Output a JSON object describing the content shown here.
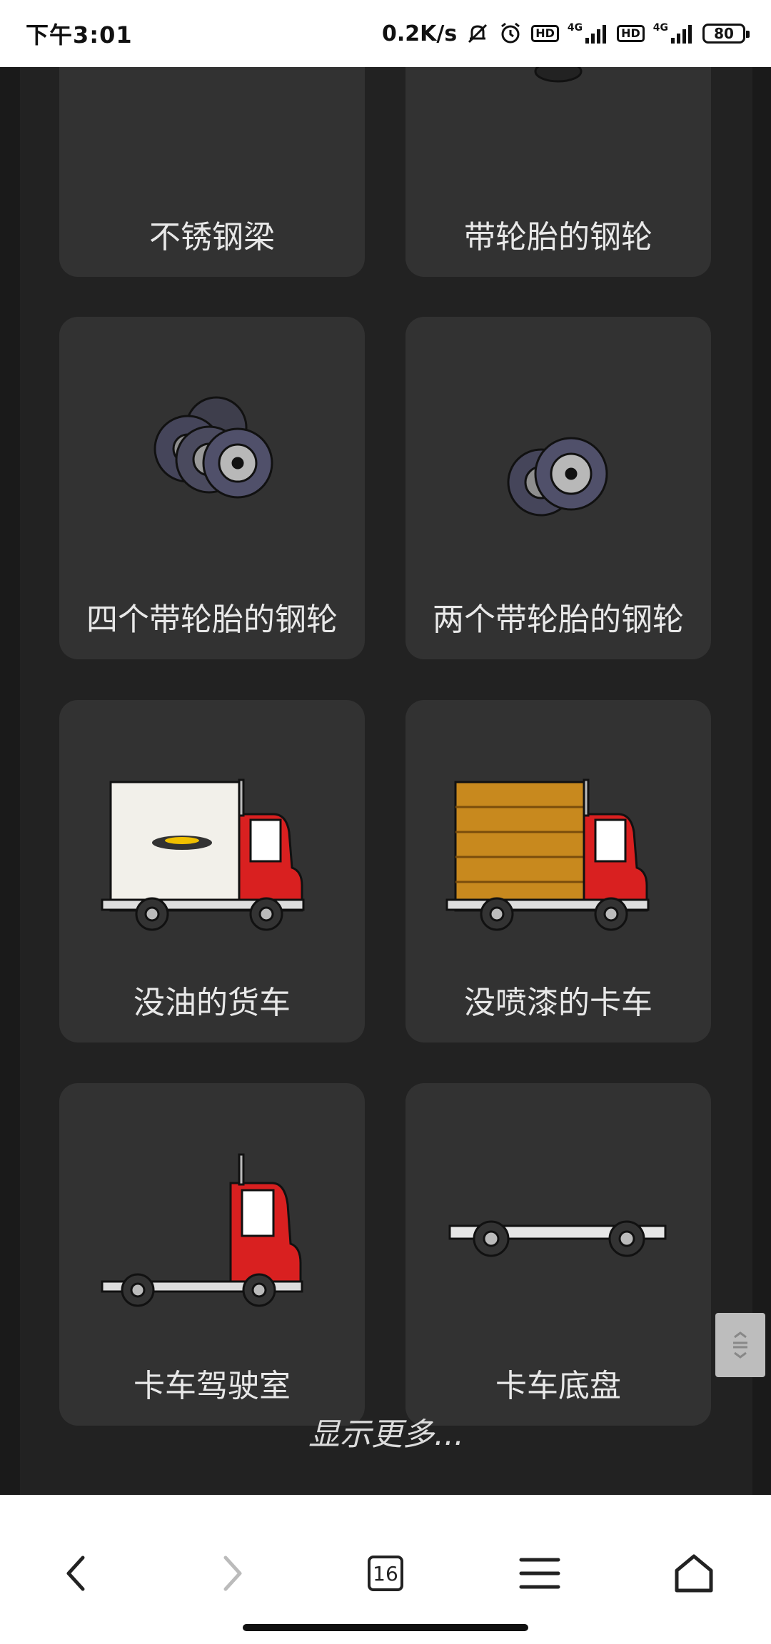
{
  "status_bar": {
    "time": "下午3:01",
    "net_speed": "0.2K/s",
    "hd_badge": "HD",
    "network": "4G",
    "battery": "80"
  },
  "items": [
    {
      "label": "不锈钢梁",
      "icon": "stainless-steel-beam"
    },
    {
      "label": "带轮胎的钢轮",
      "icon": "steel-wheel-with-tire"
    },
    {
      "label": "四个带轮胎的钢轮",
      "icon": "four-steel-wheels"
    },
    {
      "label": "两个带轮胎的钢轮",
      "icon": "two-steel-wheels"
    },
    {
      "label": "没油的货车",
      "icon": "empty-fuel-truck"
    },
    {
      "label": "没喷漆的卡车",
      "icon": "unpainted-truck"
    },
    {
      "label": "卡车驾驶室",
      "icon": "truck-cab"
    },
    {
      "label": "卡车底盘",
      "icon": "truck-chassis"
    }
  ],
  "show_more": "显示更多...",
  "bottom_bar": {
    "tab_count": "16"
  }
}
